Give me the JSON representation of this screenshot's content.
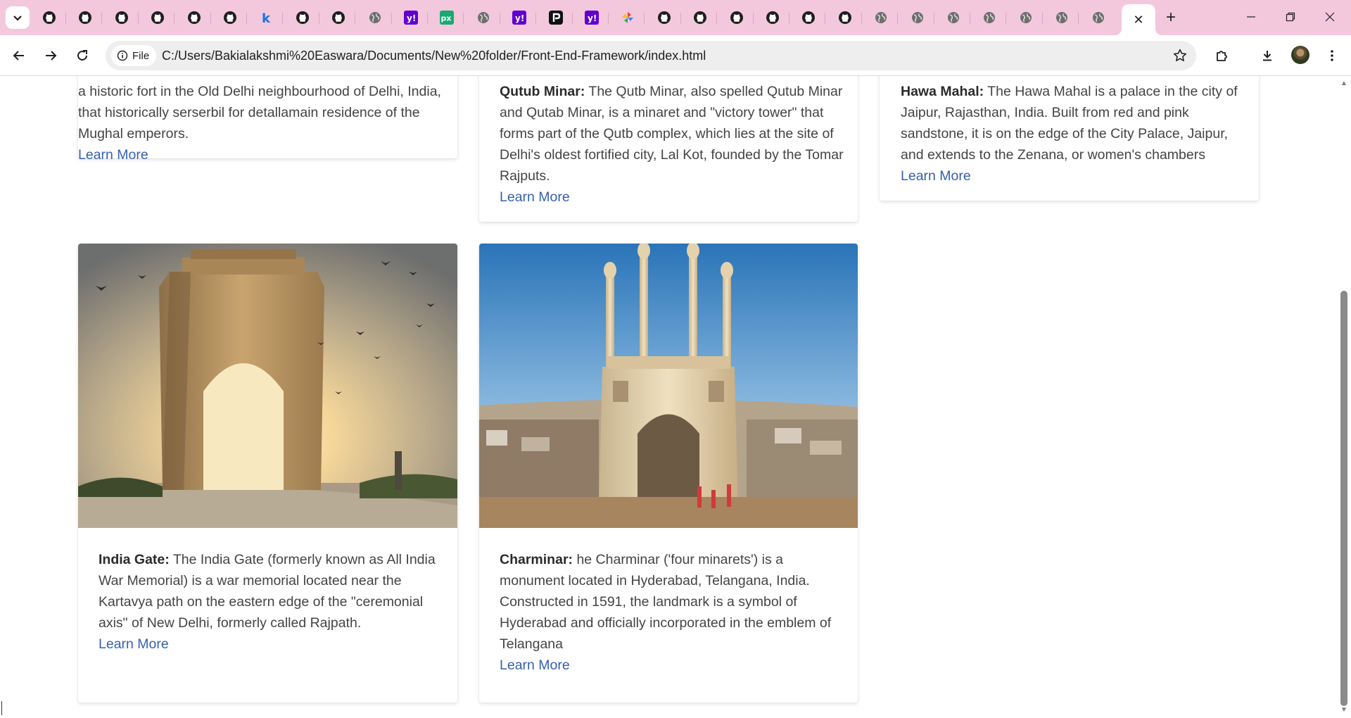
{
  "browser": {
    "tabs": [
      {
        "icon": "github-icon"
      },
      {
        "icon": "github-icon"
      },
      {
        "icon": "github-icon"
      },
      {
        "icon": "github-icon"
      },
      {
        "icon": "github-icon"
      },
      {
        "icon": "github-icon"
      },
      {
        "icon": "k-icon"
      },
      {
        "icon": "github-icon"
      },
      {
        "icon": "github-icon"
      },
      {
        "icon": "globe-icon"
      },
      {
        "icon": "yahoo-icon"
      },
      {
        "icon": "px-icon"
      },
      {
        "icon": "globe-icon"
      },
      {
        "icon": "yahoo-icon"
      },
      {
        "icon": "p-icon"
      },
      {
        "icon": "yahoo-icon"
      },
      {
        "icon": "pinwheel-icon"
      },
      {
        "icon": "github-icon"
      },
      {
        "icon": "github-icon"
      },
      {
        "icon": "github-icon"
      },
      {
        "icon": "github-icon"
      },
      {
        "icon": "github-icon"
      },
      {
        "icon": "github-icon"
      },
      {
        "icon": "globe-icon"
      },
      {
        "icon": "globe-icon"
      },
      {
        "icon": "globe-icon"
      },
      {
        "icon": "globe-icon"
      },
      {
        "icon": "globe-icon"
      },
      {
        "icon": "globe-icon"
      },
      {
        "icon": "globe-icon"
      }
    ],
    "active_tab_close": "✕",
    "new_tab": "+",
    "site_chip": "File",
    "url": "C:/Users/Bakialakshmi%20Easwara/Documents/New%20folder/Front-End-Framework/index.html",
    "colors": {
      "tabstrip": "#f4c8dc",
      "link": "#3760b0",
      "yahoo": "#6001d2",
      "px": "#19a974",
      "k": "#1a73e8"
    }
  },
  "cards": [
    {
      "title": "",
      "text": "a historic fort in the Old Delhi neighbourhood of Delhi, India, that historically serserbil for detallamain residence of the Mughal emperors.",
      "link": "Learn More"
    },
    {
      "title": "Qutub Minar:",
      "text": "The Qutb Minar, also spelled Qutub Minar and Qutab Minar, is a minaret and \"victory tower\" that forms part of the Qutb complex, which lies at the site of Delhi's oldest fortified city, Lal Kot, founded by the Tomar Rajputs.",
      "link": "Learn More"
    },
    {
      "title": "Hawa Mahal:",
      "text": "The Hawa Mahal is a palace in the city of Jaipur, Rajasthan, India. Built from red and pink sandstone, it is on the edge of the City Palace, Jaipur, and extends to the Zenana, or women's chambers",
      "link": "Learn More"
    },
    {
      "title": "India Gate:",
      "text": "The India Gate (formerly known as All India War Memorial) is a war memorial located near the Kartavya path on the eastern edge of the \"ceremonial axis\" of New Delhi, formerly called Rajpath.",
      "link": "Learn More",
      "image": "india-gate-photo"
    },
    {
      "title": "Charminar:",
      "text": "he Charminar ('four minarets') is a monument located in Hyderabad, Telangana, India. Constructed in 1591, the landmark is a symbol of Hyderabad and officially incorporated in the emblem of Telangana",
      "link": "Learn More",
      "image": "charminar-photo"
    }
  ]
}
